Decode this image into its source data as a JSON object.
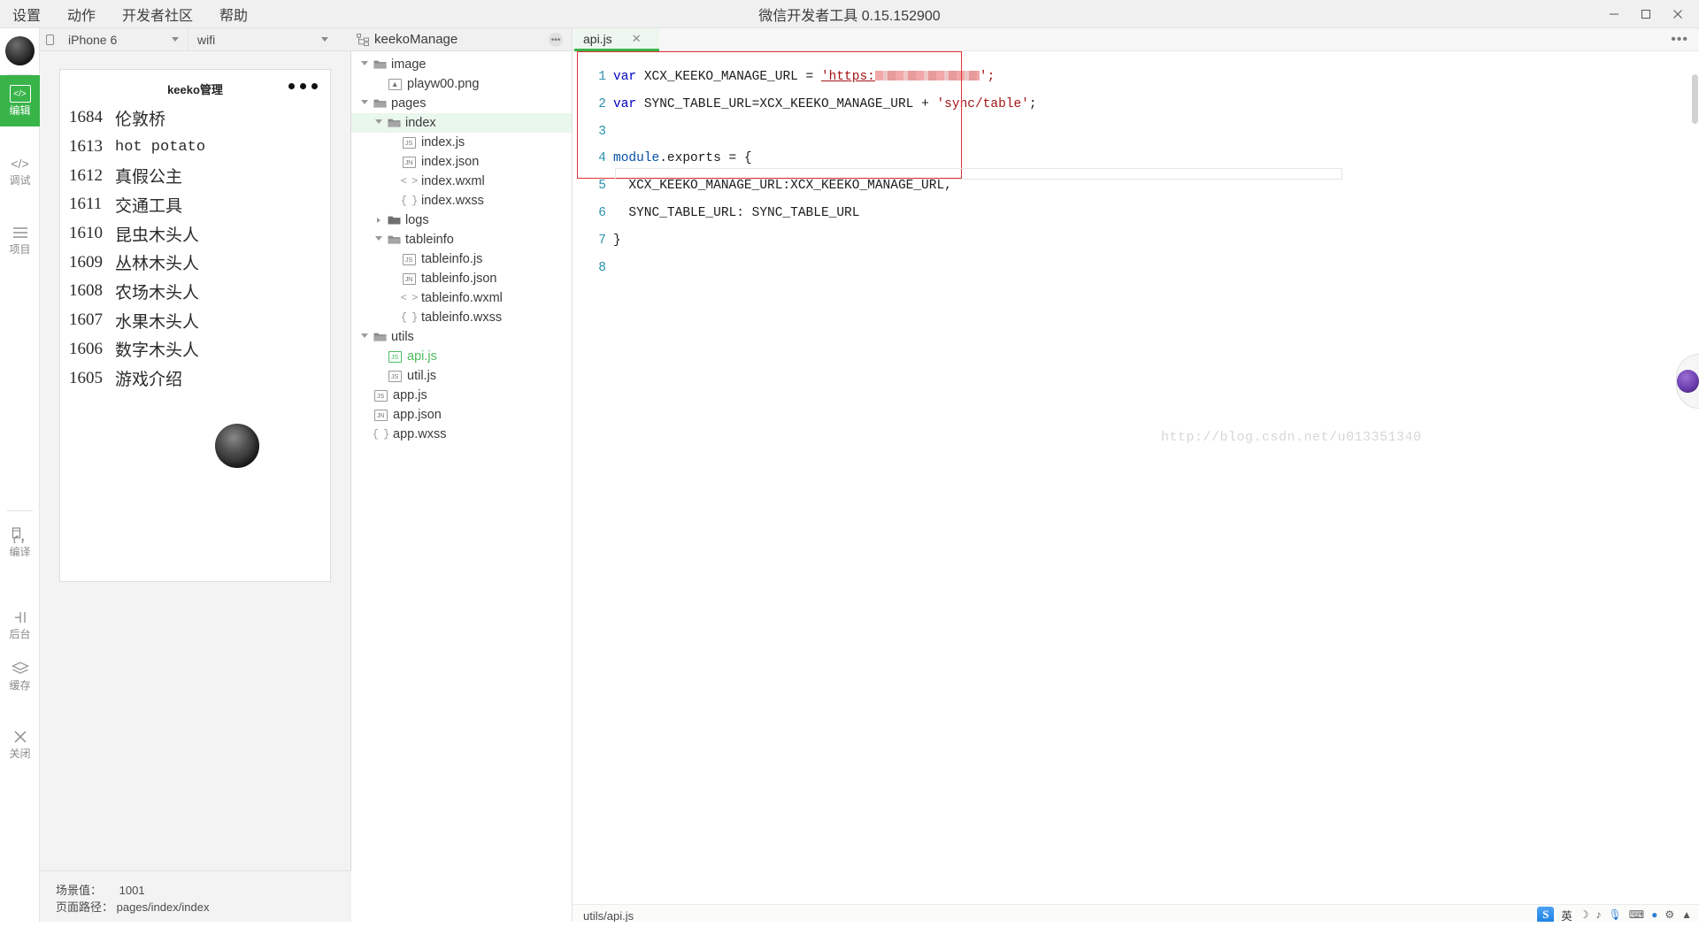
{
  "window": {
    "title": "微信开发者工具 0.15.152900",
    "minimize_label": "—",
    "maximize_label": "❐",
    "close_label": "✕"
  },
  "menubar": {
    "items": [
      {
        "label": "设置"
      },
      {
        "label": "动作"
      },
      {
        "label": "开发者社区"
      },
      {
        "label": "帮助"
      }
    ]
  },
  "rail": {
    "items": [
      {
        "label": "编辑",
        "icon": "code-icon",
        "glyph": "</>",
        "active": true
      },
      {
        "label": "调试",
        "icon": "debug-icon",
        "glyph": "</>",
        "active": false
      },
      {
        "label": "项目",
        "icon": "project-icon",
        "glyph": "☰",
        "active": false
      },
      {
        "label": "编译",
        "icon": "compile-icon",
        "glyph": "↻",
        "active": false
      },
      {
        "label": "后台",
        "icon": "background-icon",
        "glyph": "┤├",
        "active": false
      },
      {
        "label": "缓存",
        "icon": "cache-icon",
        "glyph": "☰",
        "active": false
      },
      {
        "label": "关闭",
        "icon": "close-x-icon",
        "glyph": "✕",
        "active": false
      }
    ]
  },
  "simulator": {
    "device_select": "iPhone 6",
    "network_select": "wifi",
    "phone": {
      "title": "keeko管理",
      "more_icon": "more-dots-icon",
      "rows": [
        {
          "id": "1684",
          "name": "伦敦桥",
          "mono": false
        },
        {
          "id": "1613",
          "name": "hot potato",
          "mono": true
        },
        {
          "id": "1612",
          "name": "真假公主",
          "mono": false
        },
        {
          "id": "1611",
          "name": "交通工具",
          "mono": false
        },
        {
          "id": "1610",
          "name": "昆虫木头人",
          "mono": false
        },
        {
          "id": "1609",
          "name": "丛林木头人",
          "mono": false
        },
        {
          "id": "1608",
          "name": "农场木头人",
          "mono": false
        },
        {
          "id": "1607",
          "name": "水果木头人",
          "mono": false
        },
        {
          "id": "1606",
          "name": "数字木头人",
          "mono": false
        },
        {
          "id": "1605",
          "name": "游戏介绍",
          "mono": false
        }
      ]
    },
    "footer": {
      "scene_label": "场景值：",
      "scene_value": "1001",
      "path_label": "页面路径：",
      "path_value": "pages/index/index"
    }
  },
  "tree": {
    "project_name": "keekoManage",
    "header_icon": "sitemap-icon",
    "more_icon": "more-icon",
    "nodes": [
      {
        "label": "image",
        "type": "folder",
        "depth": 0,
        "open": true,
        "selected": false
      },
      {
        "label": "playw00.png",
        "type": "img",
        "depth": 1,
        "selected": false
      },
      {
        "label": "pages",
        "type": "folder",
        "depth": 0,
        "open": true,
        "selected": false
      },
      {
        "label": "index",
        "type": "folder",
        "depth": 1,
        "open": true,
        "selected": true
      },
      {
        "label": "index.js",
        "type": "js",
        "depth": 2,
        "selected": false
      },
      {
        "label": "index.json",
        "type": "json",
        "depth": 2,
        "selected": false
      },
      {
        "label": "index.wxml",
        "type": "wxml",
        "depth": 2,
        "selected": false
      },
      {
        "label": "index.wxss",
        "type": "wxss",
        "depth": 2,
        "selected": false
      },
      {
        "label": "logs",
        "type": "folder",
        "depth": 1,
        "open": false,
        "selected": false
      },
      {
        "label": "tableinfo",
        "type": "folder",
        "depth": 1,
        "open": true,
        "selected": false
      },
      {
        "label": "tableinfo.js",
        "type": "js",
        "depth": 2,
        "selected": false
      },
      {
        "label": "tableinfo.json",
        "type": "json",
        "depth": 2,
        "selected": false
      },
      {
        "label": "tableinfo.wxml",
        "type": "wxml",
        "depth": 2,
        "selected": false
      },
      {
        "label": "tableinfo.wxss",
        "type": "wxss",
        "depth": 2,
        "selected": false
      },
      {
        "label": "utils",
        "type": "folder",
        "depth": 0,
        "open": true,
        "selected": false
      },
      {
        "label": "api.js",
        "type": "js",
        "depth": 1,
        "selected": false,
        "active": true
      },
      {
        "label": "util.js",
        "type": "js",
        "depth": 1,
        "selected": false
      },
      {
        "label": "app.js",
        "type": "js",
        "depth": 0,
        "selected": false
      },
      {
        "label": "app.json",
        "type": "json",
        "depth": 0,
        "selected": false
      },
      {
        "label": "app.wxss",
        "type": "wxss",
        "depth": 0,
        "selected": false
      }
    ],
    "badges": {
      "js": "JS",
      "json": "JN",
      "wxml": "< >",
      "wxss": "{ }",
      "img": "◩"
    }
  },
  "editor": {
    "tab": {
      "label": "api.js",
      "close_icon": "close-icon"
    },
    "more_icon": "more-dots-icon",
    "code_lines": [
      {
        "n": "1",
        "segments": [
          {
            "t": "var ",
            "c": "kw"
          },
          {
            "t": "XCX_KEEKO_MANAGE_URL = ",
            "c": ""
          },
          {
            "t": "'https:",
            "c": "lnk"
          },
          {
            "t": "[redacted]",
            "c": "redact"
          },
          {
            "t": "';",
            "c": "str"
          }
        ]
      },
      {
        "n": "2",
        "segments": [
          {
            "t": "var ",
            "c": "kw"
          },
          {
            "t": "SYNC_TABLE_URL=XCX_KEEKO_MANAGE_URL + ",
            "c": ""
          },
          {
            "t": "'sync/table'",
            "c": "str"
          },
          {
            "t": ";",
            "c": ""
          }
        ]
      },
      {
        "n": "3",
        "segments": []
      },
      {
        "n": "4",
        "segments": [
          {
            "t": "module",
            "c": "obj"
          },
          {
            "t": ".exports = {",
            "c": ""
          }
        ]
      },
      {
        "n": "5",
        "segments": [
          {
            "t": "  XCX_KEEKO_MANAGE_URL:XCX_KEEKO_MANAGE_URL,",
            "c": ""
          }
        ]
      },
      {
        "n": "6",
        "segments": [
          {
            "t": "  SYNC_TABLE_URL: SYNC_TABLE_URL",
            "c": ""
          }
        ]
      },
      {
        "n": "7",
        "segments": [
          {
            "t": "}",
            "c": ""
          }
        ]
      },
      {
        "n": "8",
        "segments": []
      }
    ],
    "watermark": "http://blog.csdn.net/u013351340",
    "status_path": "utils/api.js"
  },
  "tray": {
    "logo": "S",
    "items": [
      "☽",
      "♪",
      "↻",
      "⌘",
      "●",
      "⚙",
      "▲"
    ],
    "lang": "英"
  },
  "colors": {
    "accent_green": "#38b449",
    "tab_active_bg": "#eef7ef",
    "tree_selected": "#e9f7ec",
    "redbox": "#e03131",
    "gutter": "#2b91af",
    "keyword": "#0000c0",
    "string": "#a31515"
  }
}
